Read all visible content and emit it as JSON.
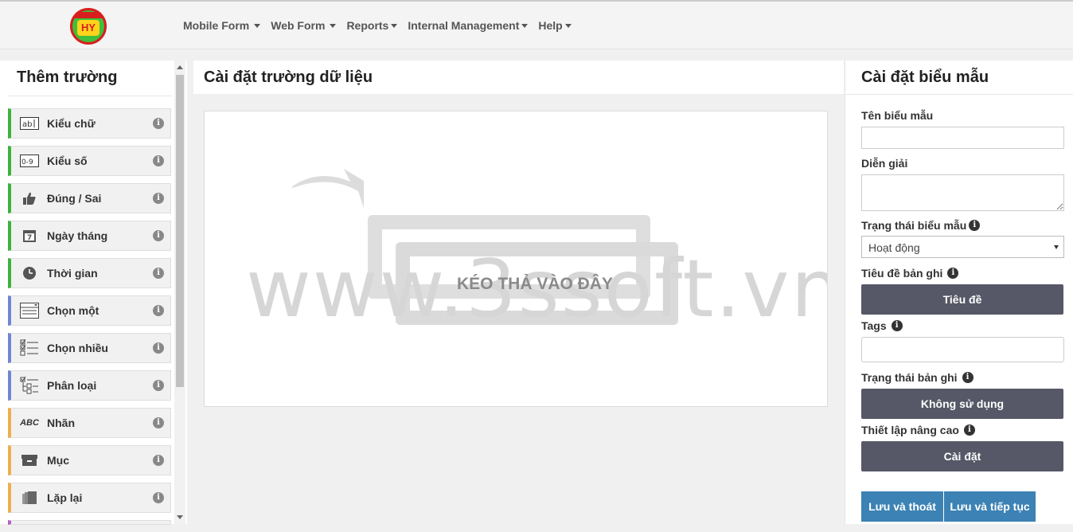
{
  "header": {
    "logo_text": "HY",
    "nav": [
      {
        "label": "Mobile Form"
      },
      {
        "label": "Web Form"
      },
      {
        "label": "Reports"
      },
      {
        "label": "Internal Management"
      },
      {
        "label": "Help"
      }
    ]
  },
  "left_panel": {
    "title": "Thêm trường",
    "fields": [
      {
        "label": "Kiểu chữ",
        "icon": "text-field-icon",
        "glyph": "ab|",
        "color": "green"
      },
      {
        "label": "Kiểu số",
        "icon": "number-field-icon",
        "glyph": "0-9",
        "color": "green"
      },
      {
        "label": "Đúng / Sai",
        "icon": "thumbs-up-icon",
        "glyph": "👍",
        "color": "green"
      },
      {
        "label": "Ngày tháng",
        "icon": "calendar-icon",
        "glyph": "7",
        "color": "green"
      },
      {
        "label": "Thời gian",
        "icon": "clock-icon",
        "glyph": "🕒",
        "color": "green"
      },
      {
        "label": "Chọn một",
        "icon": "single-select-icon",
        "glyph": "☰",
        "color": "blue"
      },
      {
        "label": "Chọn nhiều",
        "icon": "multi-select-icon",
        "glyph": "☑",
        "color": "blue"
      },
      {
        "label": "Phân loại",
        "icon": "category-tree-icon",
        "glyph": "⊞",
        "color": "blue"
      },
      {
        "label": "Nhãn",
        "icon": "label-abc-icon",
        "glyph": "ABC",
        "color": "orange"
      },
      {
        "label": "Mục",
        "icon": "section-box-icon",
        "glyph": "▭",
        "color": "orange"
      },
      {
        "label": "Lặp lại",
        "icon": "repeat-icon",
        "glyph": "❐",
        "color": "orange"
      }
    ],
    "info_glyph": "i"
  },
  "middle": {
    "title": "Cài đặt trường dữ liệu",
    "drop_text": "KÉO THẢ VÀO ĐÂY",
    "watermark": "www.3ssoft.vn"
  },
  "right_panel": {
    "title": "Cài đặt biểu mẫu",
    "form_name_label": "Tên biểu mẫu",
    "form_name_value": "",
    "description_label": "Diễn giải",
    "description_value": "",
    "form_status_label": "Trạng thái biểu mẫu",
    "form_status_value": "Hoạt động",
    "record_title_label": "Tiêu đề bản ghi",
    "record_title_button": "Tiêu đề",
    "tags_label": "Tags",
    "tags_value": "",
    "record_status_label": "Trạng thái bản ghi",
    "record_status_button": "Không sử dụng",
    "advanced_label": "Thiết lập nâng cao",
    "advanced_button": "Cài đặt",
    "save_exit": "Lưu và thoát",
    "save_continue": "Lưu và tiếp tục"
  },
  "colors": {
    "green": "#3bb33b",
    "blue": "#6f86d6",
    "orange": "#f0ad4e",
    "dark_button": "#565867",
    "primary_button": "#3c82b4"
  }
}
